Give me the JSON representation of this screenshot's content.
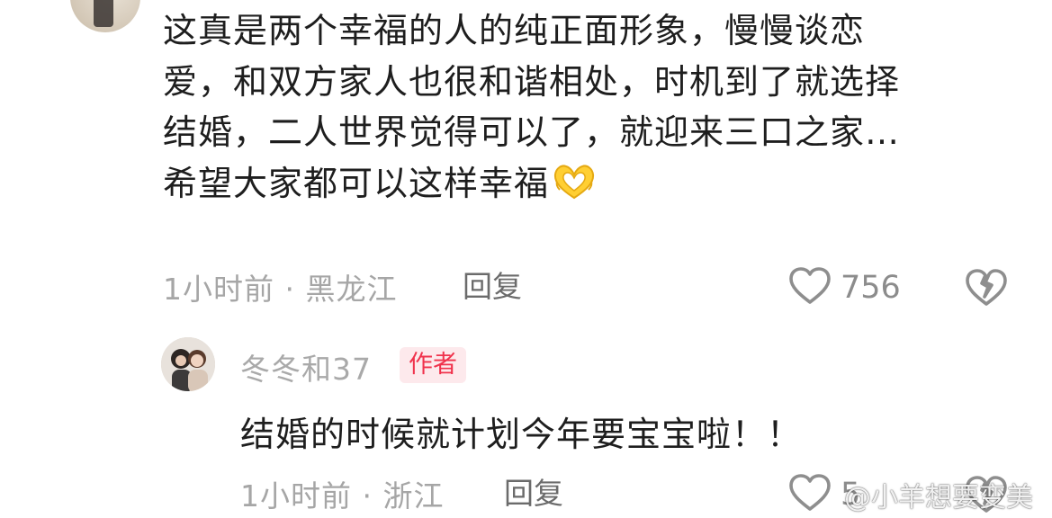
{
  "comment": {
    "lines": [
      "这真是两个幸福的人的纯正面形象，慢慢谈恋",
      "爱，和双方家人也很和谐相处，时机到了就选择",
      "结婚，二人世界觉得可以了，就迎来三口之家…",
      "希望大家都可以这样幸福"
    ],
    "emoji": "heart-hands",
    "meta": "1小时前 · 黑龙江",
    "reply_label": "回复",
    "like_count": "756"
  },
  "reply": {
    "author": "冬冬和37",
    "badge": "作者",
    "text": "结婚的时候就计划今年要宝宝啦！！",
    "meta": "1小时前 · 浙江",
    "reply_label": "回复",
    "like_count": "5"
  },
  "watermark": "@小羊想要变美",
  "colors": {
    "badge_bg": "#fde9ec",
    "badge_text": "#f0324c",
    "meta_gray": "#a6a6a6",
    "icon_gray": "#9a9a9a"
  }
}
